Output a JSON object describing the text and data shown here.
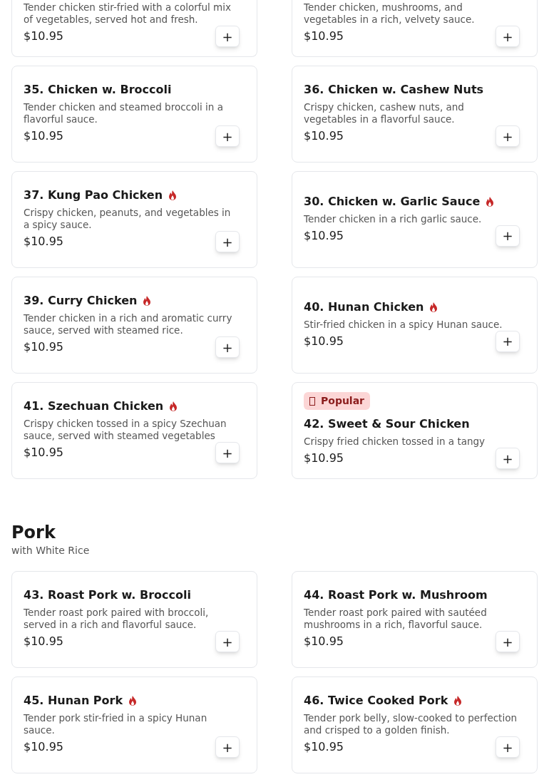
{
  "sections": [
    {
      "items": [
        {
          "description": "Tender chicken stir-fried with a colorful mix of vegetables, served hot and fresh.",
          "price": "$10.95",
          "add": "+"
        },
        {
          "description": "Tender chicken, mushrooms, and vegetables in a rich, velvety sauce.",
          "price": "$10.95",
          "add": "+"
        },
        {
          "title": "35. Chicken w. Broccoli",
          "description": "Tender chicken and steamed broccoli in a flavorful sauce.",
          "price": "$10.95",
          "spicy": false,
          "add": "+"
        },
        {
          "title": "36. Chicken w. Cashew Nuts",
          "description": "Crispy chicken, cashew nuts, and vegetables in a flavorful sauce.",
          "price": "$10.95",
          "spicy": false,
          "add": "+"
        },
        {
          "title": "37. Kung Pao Chicken",
          "description": "Crispy chicken, peanuts, and vegetables in a spicy sauce.",
          "price": "$10.95",
          "spicy": true,
          "add": "+"
        },
        {
          "title": "30. Chicken w. Garlic Sauce",
          "description": "Tender chicken in a rich garlic sauce.",
          "price": "$10.95",
          "spicy": true,
          "add": "+"
        },
        {
          "title": "39. Curry Chicken",
          "description": "Tender chicken in a rich and aromatic curry sauce, served with steamed rice.",
          "price": "$10.95",
          "spicy": true,
          "add": "+"
        },
        {
          "title": "40. Hunan Chicken",
          "description": "Stir-fried chicken in a spicy Hunan sauce.",
          "price": "$10.95",
          "spicy": true,
          "add": "+"
        },
        {
          "title": "41. Szechuan Chicken",
          "description": "Crispy chicken tossed in a spicy Szechuan sauce, served with steamed vegetables",
          "price": "$10.95",
          "spicy": true,
          "add": "+"
        },
        {
          "badge": "Popular",
          "title": "42. Sweet & Sour Chicken",
          "description": "Crispy fried chicken tossed in a tangy",
          "price": "$10.95",
          "spicy": false,
          "add": "+"
        }
      ]
    },
    {
      "title": "Pork",
      "subtitle": "with White Rice",
      "items": [
        {
          "title": "43. Roast Pork w. Broccoli",
          "description": "Tender roast pork paired with broccoli, served in a rich and flavorful sauce.",
          "price": "$10.95",
          "spicy": false,
          "add": "+"
        },
        {
          "title": "44. Roast Pork w. Mushroom",
          "description": "Tender roast pork paired with sautéed mushrooms in a rich, flavorful sauce.",
          "price": "$10.95",
          "spicy": false,
          "add": "+"
        },
        {
          "title": "45. Hunan Pork",
          "description": "Tender pork stir-fried in a spicy Hunan sauce.",
          "price": "$10.95",
          "spicy": true,
          "add": "+"
        },
        {
          "title": "46. Twice Cooked Pork",
          "description": "Tender pork belly, slow-cooked to perfection and crisped to a golden finish.",
          "price": "$10.95",
          "spicy": true,
          "add": "+"
        }
      ]
    }
  ]
}
